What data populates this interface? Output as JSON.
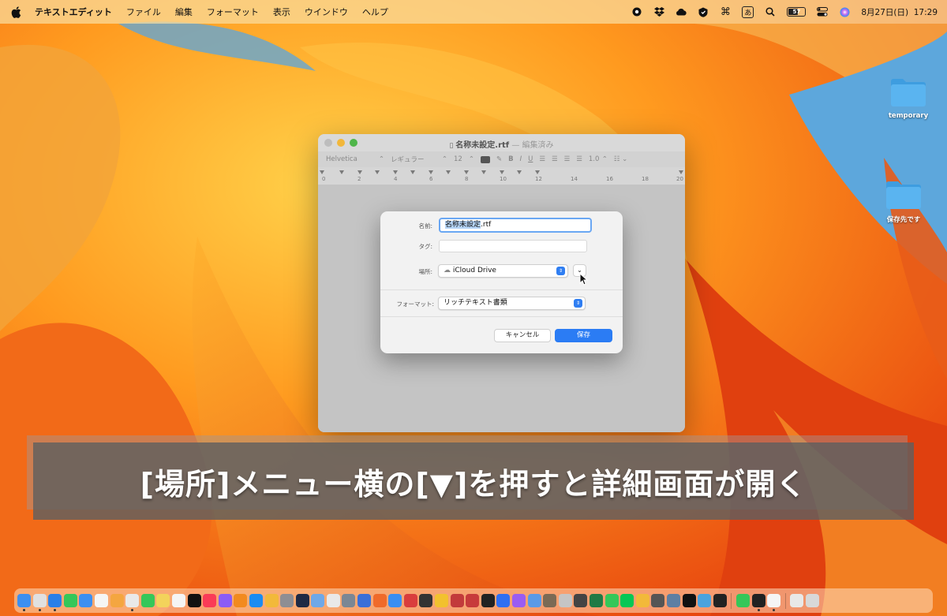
{
  "menubar": {
    "app_name": "テキストエディット",
    "items": [
      "ファイル",
      "編集",
      "フォーマット",
      "表示",
      "ウインドウ",
      "ヘルプ"
    ],
    "ime": "あ",
    "battery": "57",
    "datetime": "8月27日(日)  17:29"
  },
  "desktop": {
    "icons": [
      {
        "label": "temporary"
      },
      {
        "label": "保存先です"
      }
    ]
  },
  "window": {
    "title": "名称未設定.rtf",
    "title_status": "— 編集済み",
    "toolbar": {
      "font_family": "Helvetica",
      "font_style": "レギュラー",
      "font_size": "12",
      "line_spacing": "1.0"
    },
    "ruler": [
      "0",
      "2",
      "4",
      "6",
      "8",
      "10",
      "12",
      "14",
      "16",
      "18",
      "20"
    ]
  },
  "save_sheet": {
    "name_label": "名前:",
    "name_value_selected": "名称未設定",
    "name_value_ext": ".rtf",
    "tags_label": "タグ:",
    "location_label": "場所:",
    "location_value": "iCloud Drive",
    "format_label": "フォーマット:",
    "format_value": "リッチテキスト書類",
    "cancel_label": "キャンセル",
    "save_label": "保存"
  },
  "caption": {
    "text": "[場所]メニュー横の[▼]を押すと詳細画面が開く"
  },
  "colors": {
    "accent": "#2b7cf4",
    "folder": "#5ab4f0"
  },
  "dock": {
    "apps": [
      "finder",
      "launchpad",
      "safari",
      "messages",
      "mail",
      "calendar",
      "photos",
      "chrome",
      "facetime",
      "notes",
      "reminders",
      "tv",
      "music",
      "podcasts",
      "books",
      "appstore",
      "pencil",
      "settings",
      "photoshop",
      "preview",
      "mindnode",
      "scanner",
      "appcleaner",
      "firefox",
      "keynote",
      "opera",
      "davinci",
      "chrome-canary",
      "vpn",
      "dictionary",
      "figma",
      "spark",
      "messenger",
      "image-capture",
      "keka",
      "app2",
      "terminal-alt",
      "excel",
      "facetime2",
      "line",
      "plane",
      "app3",
      "app4",
      "xit",
      "screenshot",
      "app5",
      "numbers",
      "terminal",
      "textedit",
      "downloads",
      "trash"
    ]
  }
}
